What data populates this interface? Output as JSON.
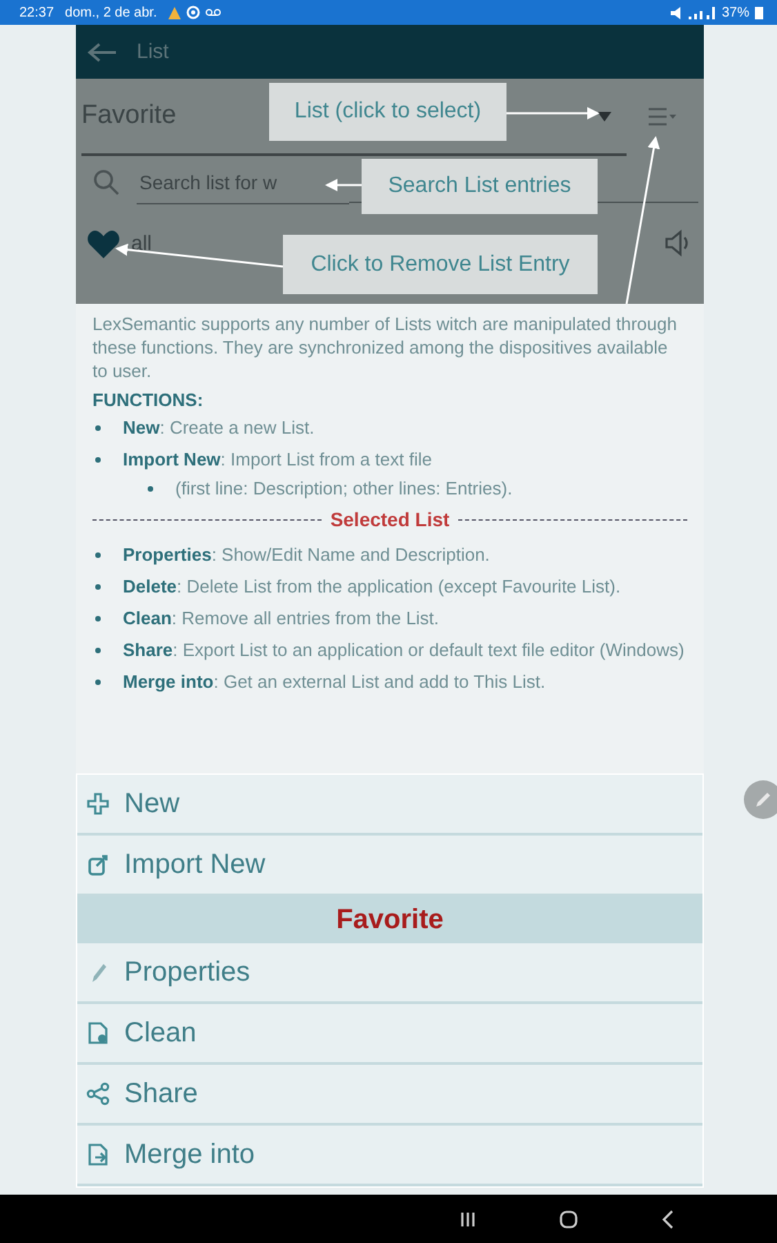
{
  "status_bar": {
    "time": "22:37",
    "date": "dom., 2 de abr.",
    "battery": "37%"
  },
  "app_bar": {
    "title": "List"
  },
  "list_selector": {
    "value": "Favorite"
  },
  "search": {
    "placeholder": "Search list for w"
  },
  "entries": [
    {
      "text": "all"
    }
  ],
  "callouts": [
    {
      "text": "List (click to select)"
    },
    {
      "text": "Search List entries"
    },
    {
      "text": "Click to Remove List Entry"
    }
  ],
  "help": {
    "intro": "LexSemantic supports  any number of Lists witch are manipulated through  these functions.  They are synchronized among the dispositives  available to user.",
    "heading": "FUNCTIONS:",
    "items": [
      {
        "text": "**New**: Create a new List."
      },
      {
        "text": "**Import New**: Import List from a text file",
        "children": [
          {
            "text": "(first line: Description; other  lines: Entries)."
          }
        ]
      }
    ],
    "separator": "Selected List",
    "selected_items": [
      {
        "text": "**Properties**: Show/Edit Name and Description."
      },
      {
        "text": "**Delete**: Delete List from  the application  (except Favourite List)."
      },
      {
        "text": "**Clean**: Remove all entries  from  the List."
      },
      {
        "text": "**Share**: Export List to an application  or default  text file editor (Windows)"
      },
      {
        "text": "**Merge into**: Get an external  List and add to This List."
      }
    ]
  },
  "menu": [
    {
      "kind": "action",
      "label": "New"
    },
    {
      "kind": "action",
      "label": "Import New"
    },
    {
      "kind": "header",
      "label": "Favorite"
    },
    {
      "kind": "action",
      "label": "Properties"
    },
    {
      "kind": "action",
      "label": "Clean"
    },
    {
      "kind": "action",
      "label": "Share"
    },
    {
      "kind": "action",
      "label": "Merge into"
    }
  ]
}
